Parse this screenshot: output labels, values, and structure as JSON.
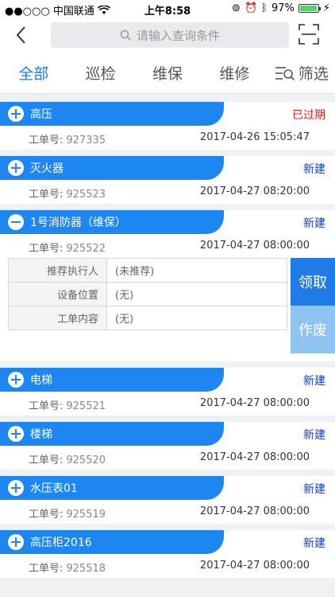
{
  "status_bar": {
    "carrier": "●●○○○ 中国联通",
    "time": "上午8:58",
    "battery": "97%",
    "battery_level": 0.97
  },
  "header": {
    "search_placeholder": "请输入查询条件"
  },
  "tabs": [
    {
      "label": "全部",
      "active": true
    },
    {
      "label": "巡检",
      "active": false
    },
    {
      "label": "维保",
      "active": false
    },
    {
      "label": "维修",
      "active": false
    }
  ],
  "filter_label": "筛选",
  "order_label": "工单号:",
  "orders": [
    {
      "title": "高压",
      "status": "已过期",
      "number": "927335",
      "time": "2017-04-26 15:05:47"
    },
    {
      "title": "灭火器",
      "status": "新建",
      "number": "925523",
      "time": "2017-04-27 08:20:00"
    },
    {
      "title": "1号消防器（维保）",
      "status": "新建",
      "number": "925522",
      "time": "2017-04-27 08:00:00"
    },
    {
      "title": "电梯",
      "status": "新建",
      "number": "925521",
      "time": "2017-04-27 08:00:00"
    },
    {
      "title": "楼梯",
      "status": "新建",
      "number": "925520",
      "time": "2017-04-27 08:00:00"
    },
    {
      "title": "水压表01",
      "status": "新建",
      "number": "925519",
      "time": "2017-04-27 08:00:00"
    },
    {
      "title": "高压柜2016",
      "status": "新建",
      "number": "925518",
      "time": "2017-04-27 08:00:00"
    }
  ],
  "detail": {
    "rows": [
      {
        "key": "推荐执行人",
        "value": "(未推荐)"
      },
      {
        "key": "设备位置",
        "value": "(无)"
      },
      {
        "key": "工单内容",
        "value": "(无)"
      }
    ],
    "claim_label": "领取",
    "void_label": "作废"
  },
  "colors": {
    "accent": "#1e86f0",
    "expired": "#e02020",
    "new_status": "#1a3fc8"
  }
}
